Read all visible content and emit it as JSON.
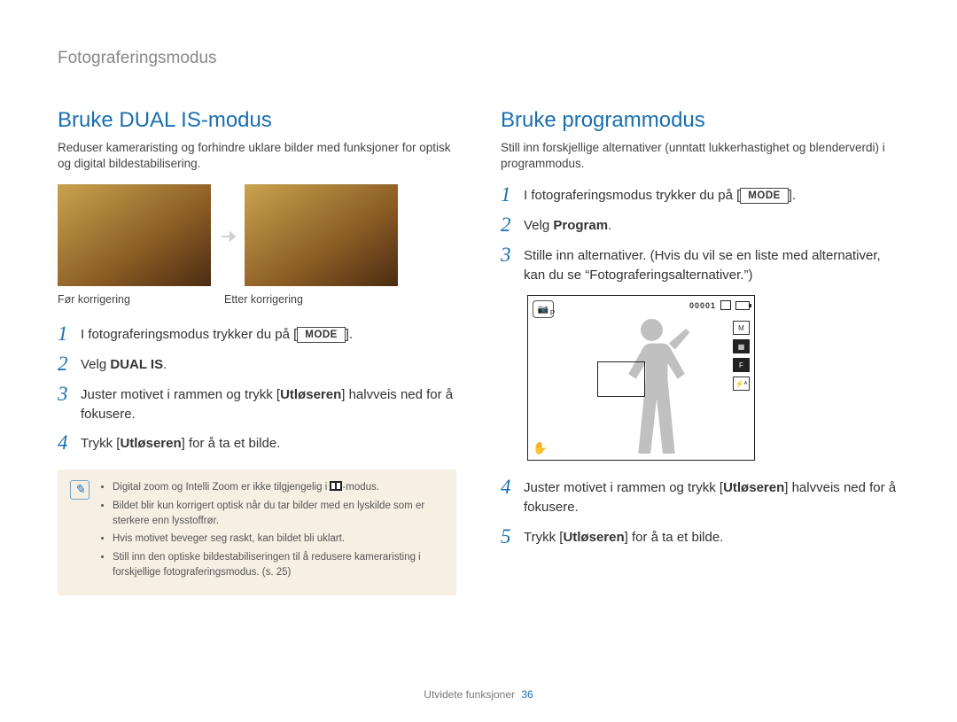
{
  "header": "Fotograferingsmodus",
  "left": {
    "title": "Bruke DUAL IS-modus",
    "intro": "Reduser kameraristing og forhindre uklare bilder med funksjoner for optisk og digital bildestabilisering.",
    "caption_before": "Før korrigering",
    "caption_after": "Etter korrigering",
    "steps": [
      {
        "n": "1",
        "pre": "I fotograferingsmodus trykker du på [",
        "chip": "MODE",
        "post": "]."
      },
      {
        "n": "2",
        "pre": "Velg ",
        "b": "DUAL IS",
        "post": "."
      },
      {
        "n": "3",
        "pre": "Juster motivet i rammen og trykk [",
        "b": "Utløseren",
        "post": "] halvveis ned for å fokusere."
      },
      {
        "n": "4",
        "pre": "Trykk [",
        "b": "Utløseren",
        "post": "] for å ta et bilde."
      }
    ],
    "notes": [
      "Digital zoom og Intelli Zoom er ikke tilgjengelig i  -modus.",
      "Bildet blir kun korrigert optisk når du tar bilder med en lyskilde som er sterkere enn lysstoffrør.",
      "Hvis motivet beveger seg raskt, kan bildet bli uklart.",
      "Still inn den optiske bildestabiliseringen til å redusere kameraristing i forskjellige fotograferingsmodus. (s. 25)"
    ]
  },
  "right": {
    "title": "Bruke programmodus",
    "intro": "Still inn forskjellige alternativer (unntatt lukkerhastighet og blenderverdi) i programmodus.",
    "steps_top": [
      {
        "n": "1",
        "pre": "I fotograferingsmodus trykker du på [",
        "chip": "MODE",
        "post": "]."
      },
      {
        "n": "2",
        "pre": "Velg ",
        "b": "Program",
        "post": "."
      },
      {
        "n": "3",
        "plain": "Stille inn alternativer. (Hvis du vil se en liste med alternativer, kan du se “Fotograferingsalternativer.”)"
      }
    ],
    "screen": {
      "corner": "P",
      "counter": "00001",
      "side": [
        "M",
        "▦",
        "F",
        "⚡ᴬ"
      ]
    },
    "steps_bottom": [
      {
        "n": "4",
        "pre": "Juster motivet i rammen og trykk [",
        "b": "Utløseren",
        "post": "] halvveis ned for å fokusere."
      },
      {
        "n": "5",
        "pre": "Trykk [",
        "b": "Utløseren",
        "post": "] for å ta et bilde."
      }
    ]
  },
  "footer": {
    "label": "Utvidete funksjoner",
    "page": "36"
  }
}
